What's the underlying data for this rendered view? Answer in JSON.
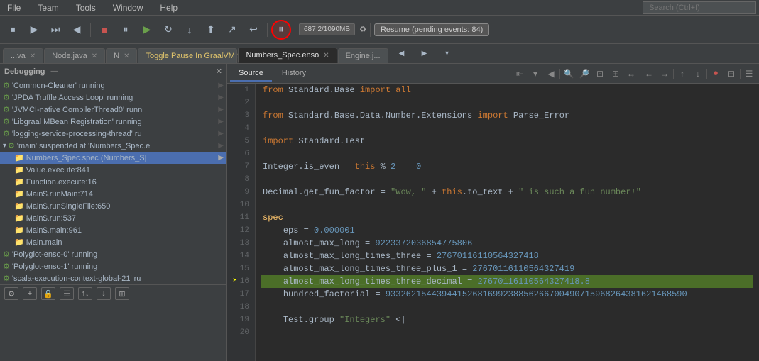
{
  "menubar": {
    "items": [
      "File",
      "Team",
      "Tools",
      "Window",
      "Help"
    ],
    "search_placeholder": "Search (Ctrl+I)"
  },
  "toolbar": {
    "memory": "687 2/1090MB",
    "resume_label": "Resume (pending events: 84)"
  },
  "tabs": [
    {
      "label": "...va",
      "active": false,
      "closeable": true
    },
    {
      "label": "Node.java",
      "active": false,
      "closeable": true
    },
    {
      "label": "N",
      "active": false,
      "closeable": true
    },
    {
      "label": "Toggle Pause In GraalVM Script",
      "active": false,
      "closeable": false
    },
    {
      "label": "Numbers_Spec.enso",
      "active": true,
      "closeable": true
    },
    {
      "label": "Engine.j...",
      "active": false,
      "closeable": false
    }
  ],
  "debug_panel": {
    "title": "Debugging",
    "threads": [
      {
        "label": "'Common-Cleaner' running",
        "type": "gear"
      },
      {
        "label": "'JPDA Truffle Access Loop' running",
        "type": "gear"
      },
      {
        "label": "'JVMCI-native CompilerThread0' runni",
        "type": "gear"
      },
      {
        "label": "'Libgraal MBean Registration' running",
        "type": "gear"
      },
      {
        "label": "'logging-service-processing-thread' ru",
        "type": "gear"
      },
      {
        "label": "'main' suspended at 'Numbers_Spec.e",
        "type": "gear",
        "suspended": true
      }
    ],
    "stack_frames": [
      {
        "label": "Numbers_Spec.spec (Numbers_S|",
        "type": "folder",
        "selected": true
      },
      {
        "label": "Value.execute:841",
        "type": "folder"
      },
      {
        "label": "Function.execute:16",
        "type": "folder"
      },
      {
        "label": "Main$.runMain:714",
        "type": "folder"
      },
      {
        "label": "Main$.runSingleFile:650",
        "type": "folder"
      },
      {
        "label": "Main$.run:537",
        "type": "folder"
      },
      {
        "label": "Main$.main:961",
        "type": "folder"
      },
      {
        "label": "Main.main",
        "type": "folder"
      }
    ],
    "other_threads": [
      {
        "label": "'Polyglot-enso-0' running",
        "type": "gear"
      },
      {
        "label": "'Polyglot-enso-1' running",
        "type": "gear"
      },
      {
        "label": "'scala-execution-context-global-21' ru",
        "type": "gear"
      }
    ]
  },
  "editor": {
    "source_tab": "Source",
    "history_tab": "History",
    "active_tab": "source",
    "code_lines": [
      {
        "num": 1,
        "text": "from Standard.Base import all"
      },
      {
        "num": 2,
        "text": ""
      },
      {
        "num": 3,
        "text": "from Standard.Base.Data.Number.Extensions import Parse_Error"
      },
      {
        "num": 4,
        "text": ""
      },
      {
        "num": 5,
        "text": "import Standard.Test"
      },
      {
        "num": 6,
        "text": ""
      },
      {
        "num": 7,
        "text": "Integer.is_even = this % 2 == 0"
      },
      {
        "num": 8,
        "text": ""
      },
      {
        "num": 9,
        "text": "Decimal.get_fun_factor = \"Wow, \" + this.to_text + \" is such a fun number!\""
      },
      {
        "num": 10,
        "text": ""
      },
      {
        "num": 11,
        "text": "spec ="
      },
      {
        "num": 12,
        "text": "    eps = 0.000001"
      },
      {
        "num": 13,
        "text": "    almost_max_long = 9223372036854775806"
      },
      {
        "num": 14,
        "text": "    almost_max_long_times_three = 27670116110564327418"
      },
      {
        "num": 15,
        "text": "    almost_max_long_times_three_plus_1 = 27670116110564327419"
      },
      {
        "num": 16,
        "text": "    almost_max_long_times_three_decimal = 27670116110564327418.8",
        "highlighted": true
      },
      {
        "num": 17,
        "text": "    hundred_factorial = 93326215443944152681699238856266700490715968264381621468590"
      },
      {
        "num": 18,
        "text": ""
      },
      {
        "num": 19,
        "text": "    Test.group \"Integers\" <|"
      },
      {
        "num": 20,
        "text": ""
      }
    ]
  }
}
